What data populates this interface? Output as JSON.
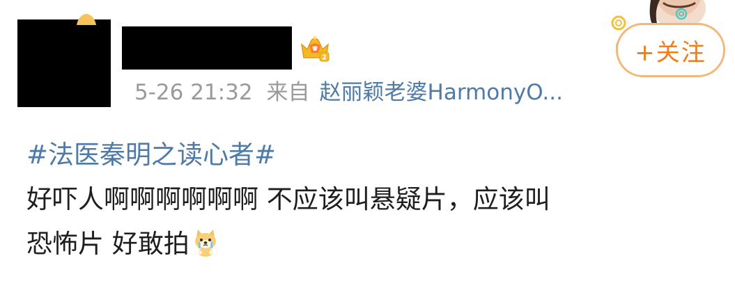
{
  "post": {
    "author": {
      "avatar_redacted": true,
      "name_redacted": true,
      "badge": "crown-icon",
      "badge_level": "2"
    },
    "meta": {
      "time": "5-26 21:32",
      "from_label": "来自",
      "device": "赵丽颖老婆HarmonyO..."
    },
    "follow_label": "+关注",
    "hashtag": "#法医秦明之读心者#",
    "text_lines": [
      "好吓人啊啊啊啊啊啊 不应该叫悬疑片，应该叫",
      "恐怖片 好敢拍"
    ],
    "emoji": "doge-cry-icon"
  },
  "colors": {
    "link": "#4e7aa8",
    "meta_gray": "#9a9a9a",
    "follow_orange": "#ee7d1c",
    "follow_border": "#f2b87a",
    "text": "#1e1e1e"
  }
}
